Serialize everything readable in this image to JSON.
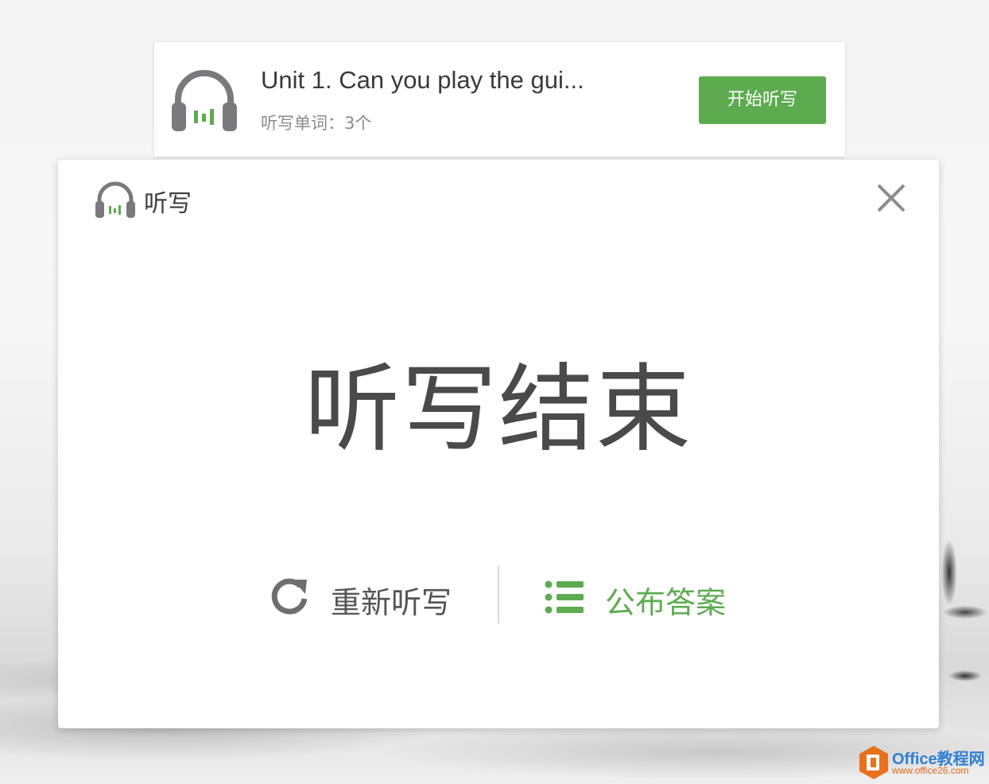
{
  "task_card": {
    "title": "Unit 1. Can you play the gui...",
    "subtitle": "听写单词：3个",
    "start_label": "开始听写"
  },
  "dialog": {
    "header_title": "听写",
    "result_title": "听写结束",
    "redo_label": "重新听写",
    "publish_label": "公布答案"
  },
  "watermark": {
    "name": "Office教程网",
    "url": "www.office26.com"
  },
  "colors": {
    "accent_green": "#5cac4f",
    "icon_gray": "#7a7a7e",
    "text_dark": "#4a4a4a"
  },
  "icons": [
    "headphone-icon",
    "close-icon",
    "refresh-icon",
    "list-icon",
    "office-logo-icon"
  ]
}
